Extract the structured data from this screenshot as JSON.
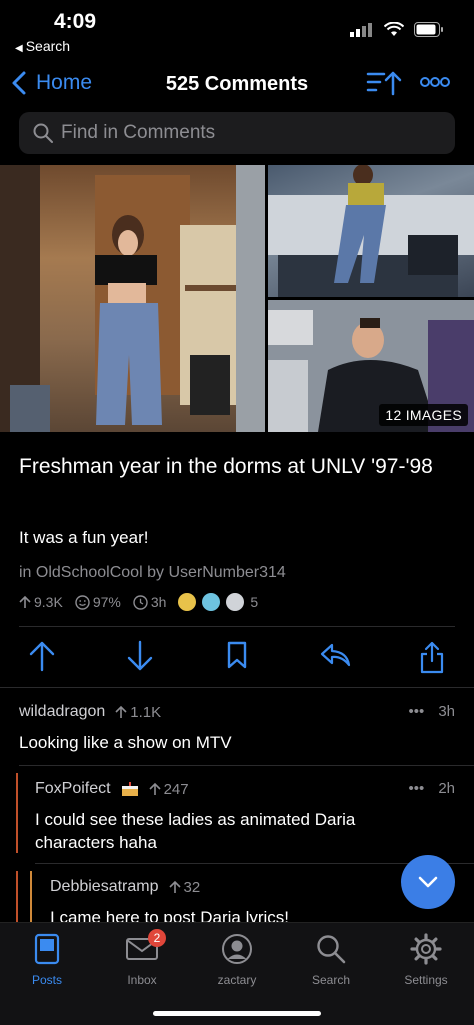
{
  "status": {
    "time": "4:09",
    "back_label": "Search"
  },
  "nav": {
    "back_label": "Home",
    "title": "525 Comments"
  },
  "search": {
    "placeholder": "Find in Comments"
  },
  "gallery": {
    "badge": "12 IMAGES"
  },
  "post": {
    "title": "Freshman year in the dorms at UNLV '97-'98",
    "body": "It was a fun year!",
    "subreddit": "OldSchoolCool",
    "author": "UserNumber314",
    "upvotes": "9.3K",
    "ratio": "97%",
    "age": "3h",
    "awards_count": "5"
  },
  "comments": [
    {
      "author": "wildadragon",
      "votes": "1.1K",
      "age": "3h",
      "body": "Looking like a show on MTV"
    },
    {
      "author": "FoxPoifect",
      "votes": "247",
      "age": "2h",
      "body": "I could see these ladies as animated Daria characters haha"
    },
    {
      "author": "Debbiesatramp",
      "votes": "32",
      "age": "",
      "body": "I came here to post Daria lyrics!"
    }
  ],
  "tabs": [
    {
      "label": "Posts",
      "icon": "posts-icon"
    },
    {
      "label": "Inbox",
      "icon": "inbox-icon",
      "badge": "2"
    },
    {
      "label": "zactary",
      "icon": "profile-icon"
    },
    {
      "label": "Search",
      "icon": "search-icon"
    },
    {
      "label": "Settings",
      "icon": "settings-icon"
    }
  ],
  "colors": {
    "accent": "#3b8bf0",
    "background": "#000000",
    "muted": "#8d8d92",
    "thread_bar": "#c0502a"
  }
}
